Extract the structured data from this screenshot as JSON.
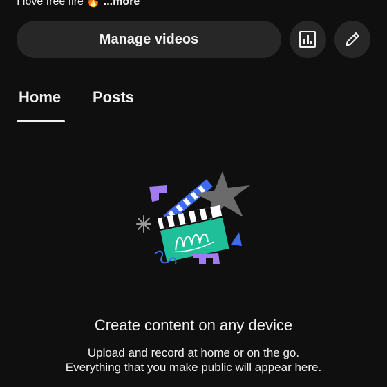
{
  "channel": {
    "description_preview": "I love free fire 🔥",
    "more_label": "...more"
  },
  "actions": {
    "manage_videos_label": "Manage videos",
    "analytics_icon": "analytics-icon",
    "edit_icon": "pencil-icon"
  },
  "tabs": [
    {
      "label": "Home",
      "selected": true
    },
    {
      "label": "Posts",
      "selected": false
    }
  ],
  "empty_state": {
    "title": "Create content on any device",
    "subtitle_line1": "Upload and record at home or on the go.",
    "subtitle_line2": "Everything that you make public will appear here."
  },
  "colors": {
    "background": "#0f0f0f",
    "button_bg": "#272727",
    "text": "#f1f1f1",
    "clapper_green": "#1fbf9a",
    "accent_blue": "#3d6cf0",
    "accent_purple": "#a07cf0",
    "star_gray": "#6b6b6b"
  }
}
